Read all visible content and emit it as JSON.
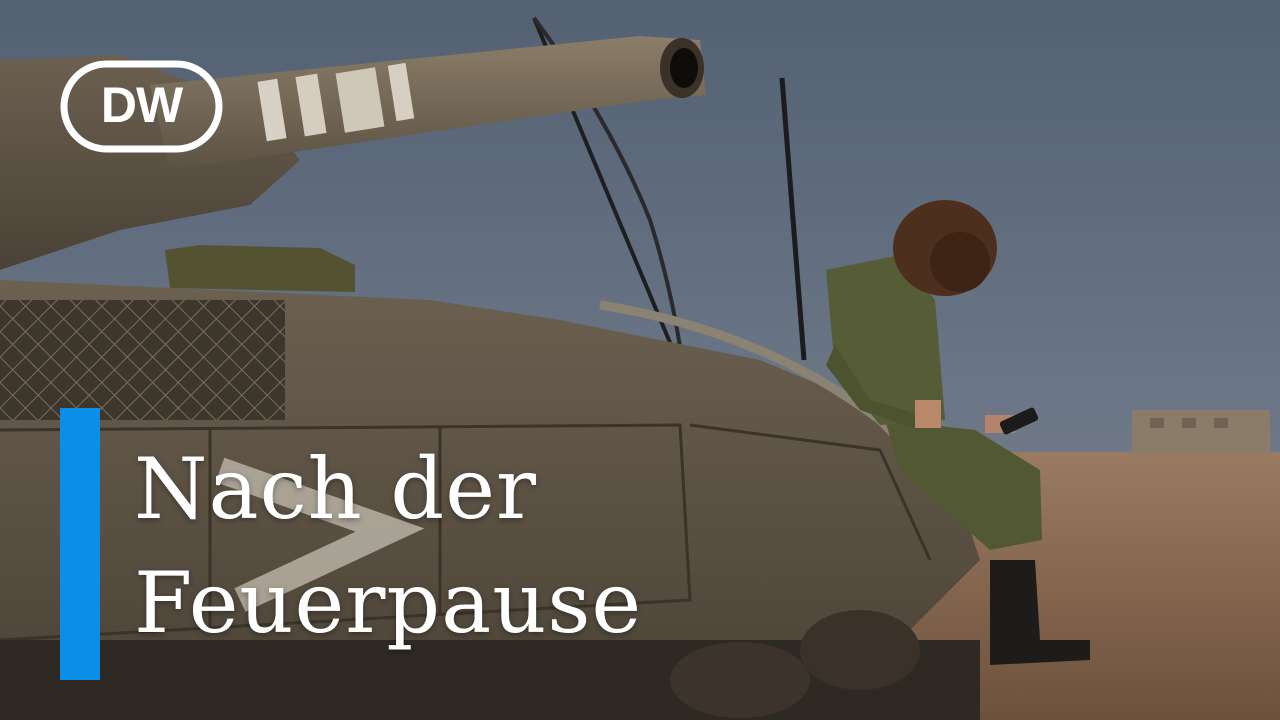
{
  "thumbnail": {
    "logo_text": "DW",
    "caption_lines": [
      "Nach der",
      "Feuerpause"
    ],
    "colors": {
      "accent_bar": "#0a8ee8",
      "caption_text": "#ffffff",
      "logo_white": "#ffffff",
      "sky": "#5f6a7a",
      "ground": "#8a6a4e"
    },
    "icons": {
      "logo": "dw-logo"
    }
  }
}
